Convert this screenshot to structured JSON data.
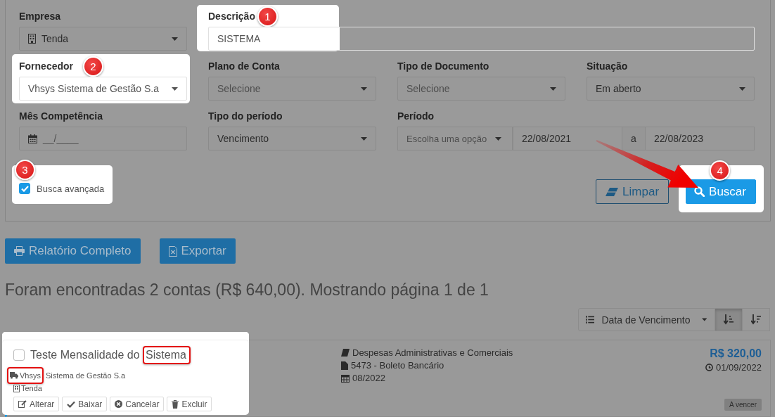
{
  "filters": [
    {
      "label": "Empresa",
      "kind": "company_select",
      "value": "Tenda"
    },
    {
      "label": "Descrição",
      "kind": "text",
      "value": "SISTEMA",
      "step": "1"
    },
    {
      "label": "Fornecedor",
      "kind": "select",
      "value": "Vhsys Sistema de Gestão S.a",
      "step": "2"
    },
    {
      "label": "Plano de Conta",
      "kind": "select",
      "placeholder": "Selecione"
    },
    {
      "label": "Tipo de Documento",
      "kind": "select",
      "placeholder": "Selecione"
    },
    {
      "label": "Situação",
      "kind": "select",
      "value": "Em aberto"
    },
    {
      "label": "Mês Competência",
      "kind": "month",
      "placeholder": "__/____"
    },
    {
      "label": "Tipo do período",
      "kind": "select",
      "value": "Vencimento"
    },
    {
      "label": "Período",
      "kind": "period",
      "preset_placeholder": "Escolha uma opção",
      "from": "22/08/2021",
      "separator": "a",
      "to": "22/08/2023"
    }
  ],
  "advanced_search": {
    "label": "Busca avançada",
    "checked": true,
    "step": "3"
  },
  "form_buttons": [
    {
      "label": "Limpar",
      "kind": "clear"
    },
    {
      "label": "Buscar",
      "kind": "search",
      "step": "4"
    }
  ],
  "list_buttons": [
    {
      "label": "Relatório Completo",
      "kind": "print"
    },
    {
      "label": "Exportar",
      "kind": "excel"
    }
  ],
  "summary": "Foram encontradas 2 contas (R$ 640,00). Mostrando página 1 de 1",
  "sort": {
    "field": "Data de Vencimento",
    "orders": [
      {
        "selected": true
      },
      {
        "selected": false
      }
    ]
  },
  "results": [
    {
      "highlighted": true,
      "checked": false,
      "title_parts": [
        {
          "text": "Teste Mensalidade do ",
          "marked": false
        },
        {
          "text": "Sistema",
          "marked": true
        }
      ],
      "supplier_parts": [
        {
          "text": "Vhsys",
          "marked": true
        },
        {
          "text": " Sistema de Gestão S.a",
          "marked": false
        }
      ],
      "company": "Tenda",
      "category": "Despesas Administrativas e Comerciais",
      "document": "5473 - Boleto Bancário",
      "month": "08/2022",
      "amount": "R$ 320,00",
      "due_date": "01/09/2022",
      "status": "A vencer",
      "actions": [
        {
          "label": "Alterar",
          "kind": "edit"
        },
        {
          "label": "Baixar",
          "kind": "settle"
        },
        {
          "label": "Cancelar",
          "kind": "cancel"
        },
        {
          "label": "Excluir",
          "kind": "delete"
        }
      ]
    }
  ]
}
